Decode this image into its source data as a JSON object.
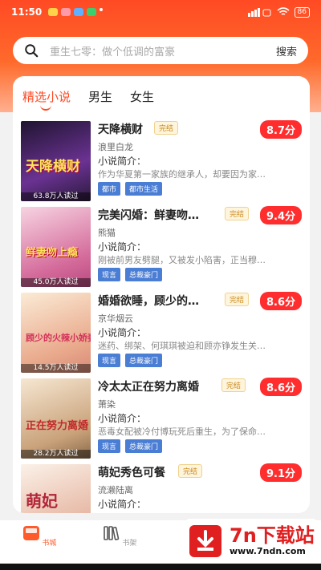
{
  "status_bar": {
    "time": "11:50",
    "battery": "86"
  },
  "search": {
    "placeholder": "重生七零：做个低调的富豪",
    "button": "搜索"
  },
  "tabs": [
    {
      "label": "精选小说",
      "active": true
    },
    {
      "label": "男生",
      "active": false
    },
    {
      "label": "女生",
      "active": false
    }
  ],
  "intro_label": "小说简介：",
  "books": [
    {
      "title": "天降横财",
      "status": "完结",
      "score": "8.7分",
      "author": "浪里白龙",
      "desc": "作为华夏第一家族的继承人，却要因为家…",
      "tags": [
        "都市",
        "都市生活"
      ],
      "cover_text": "天降横财",
      "readers": "63.8万人读过",
      "cover_colors": [
        "#2a1a3a",
        "#5b2d7a"
      ]
    },
    {
      "title": "完美闪婚：鲜妻吻…",
      "status": "完结",
      "score": "9.4分",
      "author": "熊猫",
      "desc": "刚被前男友劈腿，又被发小陷害，正当穆…",
      "tags": [
        "现言",
        "总裁豪门"
      ],
      "cover_text": "鲜妻吻上瘾",
      "readers": "45.0万人读过",
      "cover_colors": [
        "#f3c4d6",
        "#d46a9a"
      ]
    },
    {
      "title": "婚婚欲睡，顾少的…",
      "status": "完结",
      "score": "8.6分",
      "author": "京华烟云",
      "desc": "迷药、绑架、何琪琪被迫和顾亦铮发生关…",
      "tags": [
        "现言",
        "总裁豪门"
      ],
      "cover_text": "顾少的火辣小娇妻",
      "readers": "14.5万人读过",
      "cover_colors": [
        "#f7e2c8",
        "#e9a98b"
      ]
    },
    {
      "title": "冷太太正在努力离婚",
      "status": "完结",
      "score": "8.6分",
      "author": "萧染",
      "desc": "恶毒女配被冷付博玩死后重生，为了保命…",
      "tags": [
        "现言",
        "总裁豪门"
      ],
      "cover_text": "正在努力离婚",
      "readers": "28.2万人读过",
      "cover_colors": [
        "#f6e7d2",
        "#c9a27a"
      ]
    },
    {
      "title": "萌妃秀色可餐",
      "status": "完结",
      "score": "9.1分",
      "author": "流濑陆离",
      "desc": "",
      "tags": [],
      "cover_text": "萌妃",
      "readers": "",
      "cover_colors": [
        "#f8ebe0",
        "#e7b9a6"
      ]
    }
  ],
  "bottom_nav": [
    {
      "label": "书城",
      "icon": "book-icon",
      "active": true
    },
    {
      "label": "书架",
      "icon": "bookshelf-icon",
      "active": false
    }
  ],
  "watermark": {
    "name": "7n下载站",
    "url": "www.7ndn.com"
  },
  "colors": {
    "primary": "#ff4a24",
    "score": "#ff2d2d",
    "tag": "#4a7dd4"
  }
}
